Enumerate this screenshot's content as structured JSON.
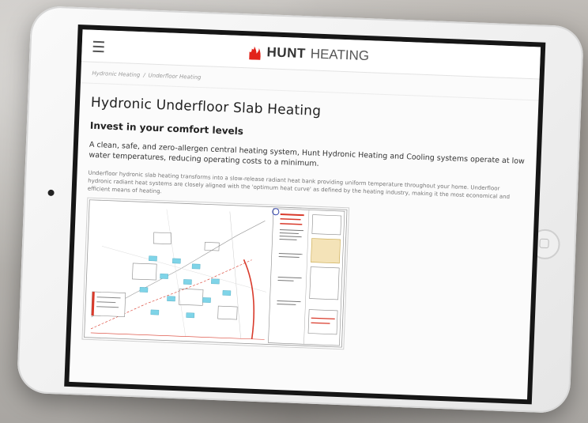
{
  "header": {
    "brand_bold": "HUNT",
    "brand_light": "HEATING",
    "brand_color": "#e2231a"
  },
  "breadcrumb": {
    "items": [
      "Hydronic Heating",
      "Underfloor Heating"
    ],
    "separator": "/"
  },
  "main": {
    "title": "Hydronic Underfloor Slab Heating",
    "subtitle": "Invest in your comfort levels",
    "lead": "A clean, safe, and zero-allergen central heating system, Hunt Hydronic Heating and Cooling systems operate at low water temperatures, reducing operating costs to a minimum.",
    "body": "Underfloor hydronic slab heating transforms into a slow-release radiant heat bank providing uniform temperature throughout your home. Underfloor hydronic radiant heat systems are closely aligned with the 'optimum heat curve' as defined by the heating industry, making it the most economical and efficient means of heating."
  },
  "drawing": {
    "icon": "floor-plan-drawing",
    "accent": "#d93a2b",
    "zone_color": "#7fd4e8"
  }
}
